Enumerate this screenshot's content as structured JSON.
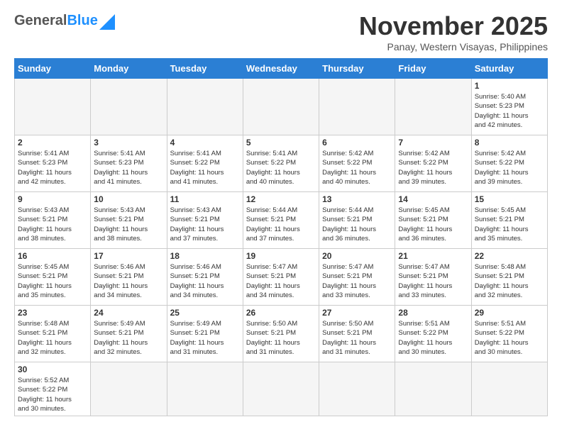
{
  "header": {
    "logo_general": "General",
    "logo_blue": "Blue",
    "title": "November 2025",
    "subtitle": "Panay, Western Visayas, Philippines"
  },
  "calendar": {
    "days_of_week": [
      "Sunday",
      "Monday",
      "Tuesday",
      "Wednesday",
      "Thursday",
      "Friday",
      "Saturday"
    ],
    "weeks": [
      [
        {
          "day": "",
          "info": ""
        },
        {
          "day": "",
          "info": ""
        },
        {
          "day": "",
          "info": ""
        },
        {
          "day": "",
          "info": ""
        },
        {
          "day": "",
          "info": ""
        },
        {
          "day": "",
          "info": ""
        },
        {
          "day": "1",
          "info": "Sunrise: 5:40 AM\nSunset: 5:23 PM\nDaylight: 11 hours\nand 42 minutes."
        }
      ],
      [
        {
          "day": "2",
          "info": "Sunrise: 5:41 AM\nSunset: 5:23 PM\nDaylight: 11 hours\nand 42 minutes."
        },
        {
          "day": "3",
          "info": "Sunrise: 5:41 AM\nSunset: 5:23 PM\nDaylight: 11 hours\nand 41 minutes."
        },
        {
          "day": "4",
          "info": "Sunrise: 5:41 AM\nSunset: 5:22 PM\nDaylight: 11 hours\nand 41 minutes."
        },
        {
          "day": "5",
          "info": "Sunrise: 5:41 AM\nSunset: 5:22 PM\nDaylight: 11 hours\nand 40 minutes."
        },
        {
          "day": "6",
          "info": "Sunrise: 5:42 AM\nSunset: 5:22 PM\nDaylight: 11 hours\nand 40 minutes."
        },
        {
          "day": "7",
          "info": "Sunrise: 5:42 AM\nSunset: 5:22 PM\nDaylight: 11 hours\nand 39 minutes."
        },
        {
          "day": "8",
          "info": "Sunrise: 5:42 AM\nSunset: 5:22 PM\nDaylight: 11 hours\nand 39 minutes."
        }
      ],
      [
        {
          "day": "9",
          "info": "Sunrise: 5:43 AM\nSunset: 5:21 PM\nDaylight: 11 hours\nand 38 minutes."
        },
        {
          "day": "10",
          "info": "Sunrise: 5:43 AM\nSunset: 5:21 PM\nDaylight: 11 hours\nand 38 minutes."
        },
        {
          "day": "11",
          "info": "Sunrise: 5:43 AM\nSunset: 5:21 PM\nDaylight: 11 hours\nand 37 minutes."
        },
        {
          "day": "12",
          "info": "Sunrise: 5:44 AM\nSunset: 5:21 PM\nDaylight: 11 hours\nand 37 minutes."
        },
        {
          "day": "13",
          "info": "Sunrise: 5:44 AM\nSunset: 5:21 PM\nDaylight: 11 hours\nand 36 minutes."
        },
        {
          "day": "14",
          "info": "Sunrise: 5:45 AM\nSunset: 5:21 PM\nDaylight: 11 hours\nand 36 minutes."
        },
        {
          "day": "15",
          "info": "Sunrise: 5:45 AM\nSunset: 5:21 PM\nDaylight: 11 hours\nand 35 minutes."
        }
      ],
      [
        {
          "day": "16",
          "info": "Sunrise: 5:45 AM\nSunset: 5:21 PM\nDaylight: 11 hours\nand 35 minutes."
        },
        {
          "day": "17",
          "info": "Sunrise: 5:46 AM\nSunset: 5:21 PM\nDaylight: 11 hours\nand 34 minutes."
        },
        {
          "day": "18",
          "info": "Sunrise: 5:46 AM\nSunset: 5:21 PM\nDaylight: 11 hours\nand 34 minutes."
        },
        {
          "day": "19",
          "info": "Sunrise: 5:47 AM\nSunset: 5:21 PM\nDaylight: 11 hours\nand 34 minutes."
        },
        {
          "day": "20",
          "info": "Sunrise: 5:47 AM\nSunset: 5:21 PM\nDaylight: 11 hours\nand 33 minutes."
        },
        {
          "day": "21",
          "info": "Sunrise: 5:47 AM\nSunset: 5:21 PM\nDaylight: 11 hours\nand 33 minutes."
        },
        {
          "day": "22",
          "info": "Sunrise: 5:48 AM\nSunset: 5:21 PM\nDaylight: 11 hours\nand 32 minutes."
        }
      ],
      [
        {
          "day": "23",
          "info": "Sunrise: 5:48 AM\nSunset: 5:21 PM\nDaylight: 11 hours\nand 32 minutes."
        },
        {
          "day": "24",
          "info": "Sunrise: 5:49 AM\nSunset: 5:21 PM\nDaylight: 11 hours\nand 32 minutes."
        },
        {
          "day": "25",
          "info": "Sunrise: 5:49 AM\nSunset: 5:21 PM\nDaylight: 11 hours\nand 31 minutes."
        },
        {
          "day": "26",
          "info": "Sunrise: 5:50 AM\nSunset: 5:21 PM\nDaylight: 11 hours\nand 31 minutes."
        },
        {
          "day": "27",
          "info": "Sunrise: 5:50 AM\nSunset: 5:21 PM\nDaylight: 11 hours\nand 31 minutes."
        },
        {
          "day": "28",
          "info": "Sunrise: 5:51 AM\nSunset: 5:22 PM\nDaylight: 11 hours\nand 30 minutes."
        },
        {
          "day": "29",
          "info": "Sunrise: 5:51 AM\nSunset: 5:22 PM\nDaylight: 11 hours\nand 30 minutes."
        }
      ],
      [
        {
          "day": "30",
          "info": "Sunrise: 5:52 AM\nSunset: 5:22 PM\nDaylight: 11 hours\nand 30 minutes."
        },
        {
          "day": "",
          "info": ""
        },
        {
          "day": "",
          "info": ""
        },
        {
          "day": "",
          "info": ""
        },
        {
          "day": "",
          "info": ""
        },
        {
          "day": "",
          "info": ""
        },
        {
          "day": "",
          "info": ""
        }
      ]
    ]
  }
}
